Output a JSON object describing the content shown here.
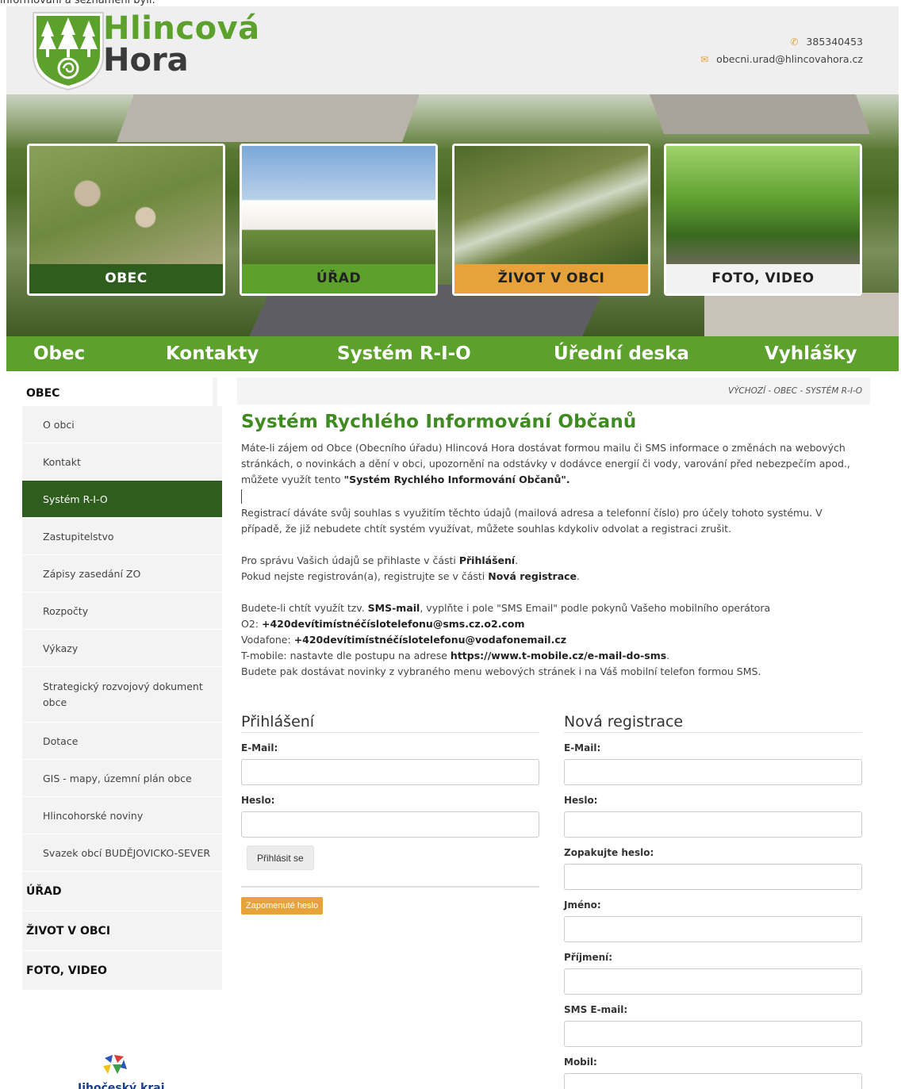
{
  "top_cut_text": "informování a seznámení byli.",
  "header": {
    "brand_line1": "Hlincová",
    "brand_line2": "Hora",
    "phone": "385340453",
    "email": "obecni.urad@hlincovahora.cz",
    "phone_icon": "phone-icon",
    "email_icon": "envelope-icon"
  },
  "tiles": [
    {
      "label": "OBEC"
    },
    {
      "label": "ÚŘAD"
    },
    {
      "label": "ŽIVOT V OBCI"
    },
    {
      "label": "FOTO, VIDEO"
    }
  ],
  "mainnav": [
    "Obec",
    "Kontakty",
    "Systém R-I-O",
    "Úřední deska",
    "Vyhlášky"
  ],
  "sidebar": {
    "section_obec": "OBEC",
    "items": [
      "O obci",
      "Kontakt",
      "Systém R-I-O",
      "Zastupitelstvo",
      "Zápisy zasedání ZO",
      "Rozpočty",
      "Výkazy",
      "Strategický rozvojový dokument obce",
      "Dotace",
      "GIS - mapy, územní plán obce",
      "Hlincohorské noviny",
      "Svazek obcí BUDĚJOVICKO-SEVER"
    ],
    "active_item": "Systém R-I-O",
    "sections": [
      "ÚŘAD",
      "ŽIVOT V OBCI",
      "FOTO, VIDEO"
    ],
    "region_logo_text": "Jihočeský kraj"
  },
  "breadcrumb": "VÝCHOZÍ - OBEC - SYSTÉM R-I-O",
  "content": {
    "title": "Systém Rychlého Informování Občanů",
    "p1": "Máte-li zájem od Obce (Obecního úřadu) Hlincová Hora dostávat formou mailu či SMS informace o změnách na webových stránkách, o novinkách a dění v obci, upozornění na odstávky v dodávce energií či vody, varování před nebezpečím apod., můžete využít tento",
    "p1_bold": "\"Systém Rychlého Informování Občanů\".",
    "p2": "Registrací dáváte svůj souhlas s využitím těchto údajů (mailová adresa a telefonní číslo) pro účely tohoto systému. V případě, že již nebudete chtít systém využívat, můžete souhlas kdykoliv odvolat a registraci zrušit.",
    "p3a": "Pro správu Vašich údajů se přihlaste v části",
    "p3a_bold": "Přihlášení",
    "p3b": "Pokud nejste registrován(a), registrujte se v části",
    "p3b_bold": "Nová registrace",
    "p4a": "Budete-li chtít využít tzv.",
    "p4a_bold": "SMS-mail",
    "p4a_rest": ", vyplňte i pole \"SMS Email\" podle pokynů Vašeho mobilního operátora",
    "o2_prefix": "O2:",
    "o2_addr": "+420devítimístnéčíslotelefonu@sms.cz.o2.com",
    "vodafone_prefix": "Vodafone:",
    "vodafone_addr": "+420devítimístnéčíslotelefonu@vodafonemail.cz",
    "tmobile_prefix": "T-mobile: nastavte dle postupu na adrese",
    "tmobile_url": "https://www.t-mobile.cz/e-mail-do-sms",
    "p5": "Budete pak dostávat novinky z vybraného menu webových stránek i na Váš mobilní telefon formou SMS."
  },
  "login": {
    "title": "Přihlášení",
    "email_label": "E-Mail:",
    "password_label": "Heslo:",
    "submit": "Přihlásit se",
    "forgot": "Zapomenuté heslo"
  },
  "register": {
    "title": "Nová registrace",
    "fields": [
      "E-Mail:",
      "Heslo:",
      "Zopakujte heslo:",
      "Jméno:",
      "Příjmení:",
      "SMS E-mail:",
      "Mobil:"
    ]
  },
  "colors": {
    "brand_green": "#5ba12b",
    "dark_green": "#2f5d1e",
    "accent_orange": "#e7a23a",
    "title_green": "#3f8b22"
  }
}
